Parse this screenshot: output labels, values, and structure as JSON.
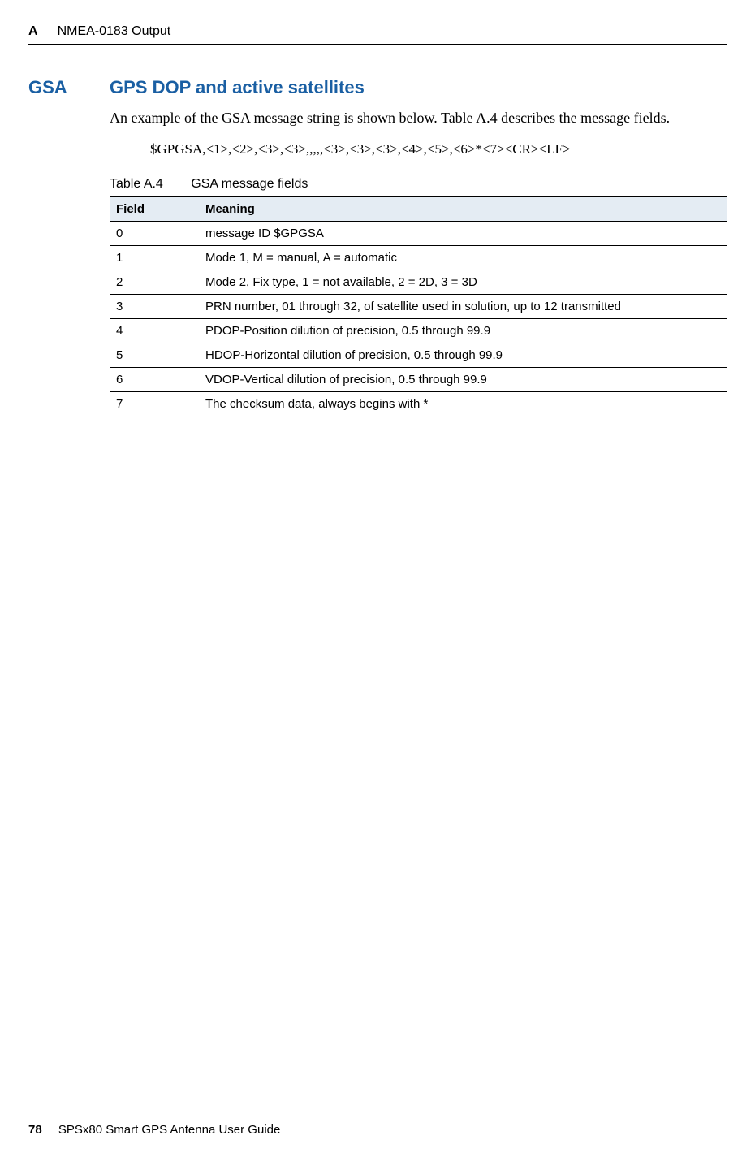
{
  "header": {
    "appendix_letter": "A",
    "title": "NMEA-0183 Output"
  },
  "section": {
    "code": "GSA",
    "heading": "GPS DOP and active satellites",
    "intro": "An example of the GSA message string is shown below. Table A.4 describes the message fields.",
    "example": "$GPGSA,<1>,<2>,<3>,<3>,,,,,<3>,<3>,<3>,<4>,<5>,<6>*<7><CR><LF>"
  },
  "table": {
    "caption_num": "Table A.4",
    "caption_title": "GSA message fields",
    "col_field": "Field",
    "col_meaning": "Meaning",
    "rows": [
      {
        "field": "0",
        "meaning": "message ID $GPGSA"
      },
      {
        "field": "1",
        "meaning": "Mode 1, M = manual, A = automatic"
      },
      {
        "field": "2",
        "meaning": "Mode 2, Fix type, 1 = not available, 2 = 2D, 3 = 3D"
      },
      {
        "field": "3",
        "meaning": "PRN number, 01 through 32, of satellite used in solution, up to 12 transmitted"
      },
      {
        "field": "4",
        "meaning": "PDOP-Position dilution of precision, 0.5 through 99.9"
      },
      {
        "field": "5",
        "meaning": "HDOP-Horizontal dilution of precision, 0.5 through 99.9"
      },
      {
        "field": "6",
        "meaning": "VDOP-Vertical dilution of precision, 0.5 through 99.9"
      },
      {
        "field": "7",
        "meaning": "The checksum data, always begins with *"
      }
    ]
  },
  "footer": {
    "page": "78",
    "doc_title": "SPSx80 Smart GPS Antenna User Guide"
  }
}
